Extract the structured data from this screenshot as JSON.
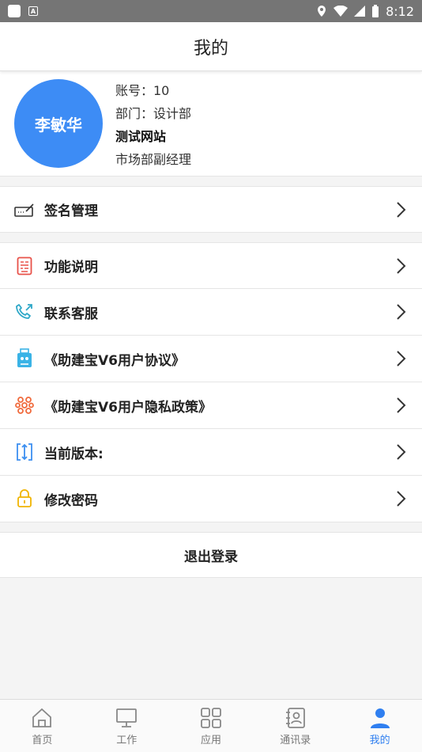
{
  "status_bar": {
    "time": "8:12"
  },
  "header": {
    "title": "我的"
  },
  "profile": {
    "avatar_name": "李敏华",
    "account": "账号：10",
    "department": "部门：设计部",
    "org": "测试网站",
    "position": "市场部副经理"
  },
  "menu": {
    "signature": "签名管理",
    "features": "功能说明",
    "support": "联系客服",
    "agreement": "《助建宝V6用户协议》",
    "privacy": "《助建宝V6用户隐私政策》",
    "version": "当前版本:",
    "password": "修改密码"
  },
  "logout": {
    "label": "退出登录"
  },
  "tabs": {
    "home": "首页",
    "work": "工作",
    "apps": "应用",
    "contacts": "通讯录",
    "mine": "我的"
  },
  "colors": {
    "accent": "#3d8cf5",
    "active_tab": "#2f7ff0"
  }
}
